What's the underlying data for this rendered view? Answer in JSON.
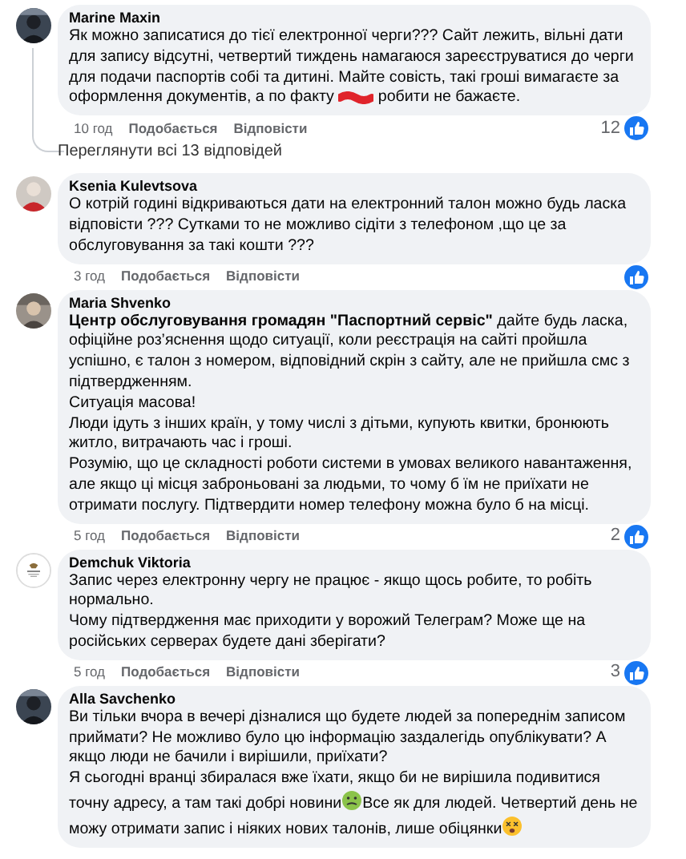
{
  "comments": [
    {
      "author": "Marine Maxin",
      "paragraphs": [
        [
          {
            "kind": "text",
            "text": "Як можно записатися до тієї електронної черги??? Сайт лежить, вільні дати для запису відсутні, четвертий тиждень намагаюся зареєструватися до черги для подачи паспортів собі та дитині. Майте совість, такі гроші вимагаєте за оформлення документів, а по факту "
          },
          {
            "kind": "redacted"
          },
          {
            "kind": "text",
            "text": " робити не бажаєте."
          }
        ]
      ],
      "time": "10 год",
      "like_label": "Подобається",
      "reply_label": "Відповісти",
      "reaction_count": "12",
      "replies_link": "Переглянути всі 13 відповідей"
    },
    {
      "author": "Ksenia Kulevtsova",
      "paragraphs": [
        [
          {
            "kind": "text",
            "text": "О котрій годині відкриваються дати на електронний талон можно будь ласка відповісти ??? Сутками то не можливо сідіти з телефоном ,що це за обслуговування за такі кошти ???"
          }
        ]
      ],
      "time": "3 год",
      "like_label": "Подобається",
      "reply_label": "Відповісти"
    },
    {
      "author": "Maria Shvenko",
      "paragraphs": [
        [
          {
            "kind": "text",
            "text": "**Центр обслуговування громадян \"Паспортний сервіс\"** дайте будь ласка, офіційне роз’яснення щодо ситуації, коли реєстрація на сайті пройшла успішно, є талон з номером, відповідний скрін з сайту, але не прийшла смс з підтвердженням."
          }
        ],
        [
          {
            "kind": "text",
            "text": "Ситуація масова!"
          }
        ],
        [
          {
            "kind": "text",
            "text": "Люди ідуть з інших країн, у тому числі з дітьми, купують квитки, бронюють житло, витрачають час і гроші."
          }
        ],
        [
          {
            "kind": "text",
            "text": "Розумію, що це складності роботи системи в умовах великого навантаження, але якщо ці місця заброньовані за людьми, то чому б їм не приїхати не отримати послугу. Підтвердити номер телефону можна було б на місці."
          }
        ]
      ],
      "time": "5 год",
      "like_label": "Подобається",
      "reply_label": "Відповісти",
      "reaction_count": "2"
    },
    {
      "author": "Demchuk Viktoria",
      "paragraphs": [
        [
          {
            "kind": "text",
            "text": "Запис через електронну чергу не працює - якщо щось робите, то робіть нормально."
          }
        ],
        [
          {
            "kind": "text",
            "text": "Чому підтвердження має приходити у ворожий Телеграм? Може ще на російських серверах будете дані зберігати?"
          }
        ]
      ],
      "time": "5 год",
      "like_label": "Подобається",
      "reply_label": "Відповісти",
      "reaction_count": "3"
    },
    {
      "author": "Alla Savchenko",
      "paragraphs": [
        [
          {
            "kind": "text",
            "text": "Ви тільки вчора в вечері дізналися що будете людей за попереднім записом приймати? Не можливо було цю інформацію заздалегідь опублікувати? А якщо люди не бачили і вирішили, приїхати?"
          }
        ],
        [
          {
            "kind": "text",
            "text": "Я сьогодні вранці збиралася вже їхати, якщо би не вирішила подивитися точну адресу, а там такі добрі новини"
          },
          {
            "kind": "sick"
          },
          {
            "kind": "text",
            "text": "Все як для людей. Четвертий день не можу отримати запис і ніяких нових талонів, лише обіцянки"
          },
          {
            "kind": "dizzy"
          }
        ]
      ]
    }
  ]
}
